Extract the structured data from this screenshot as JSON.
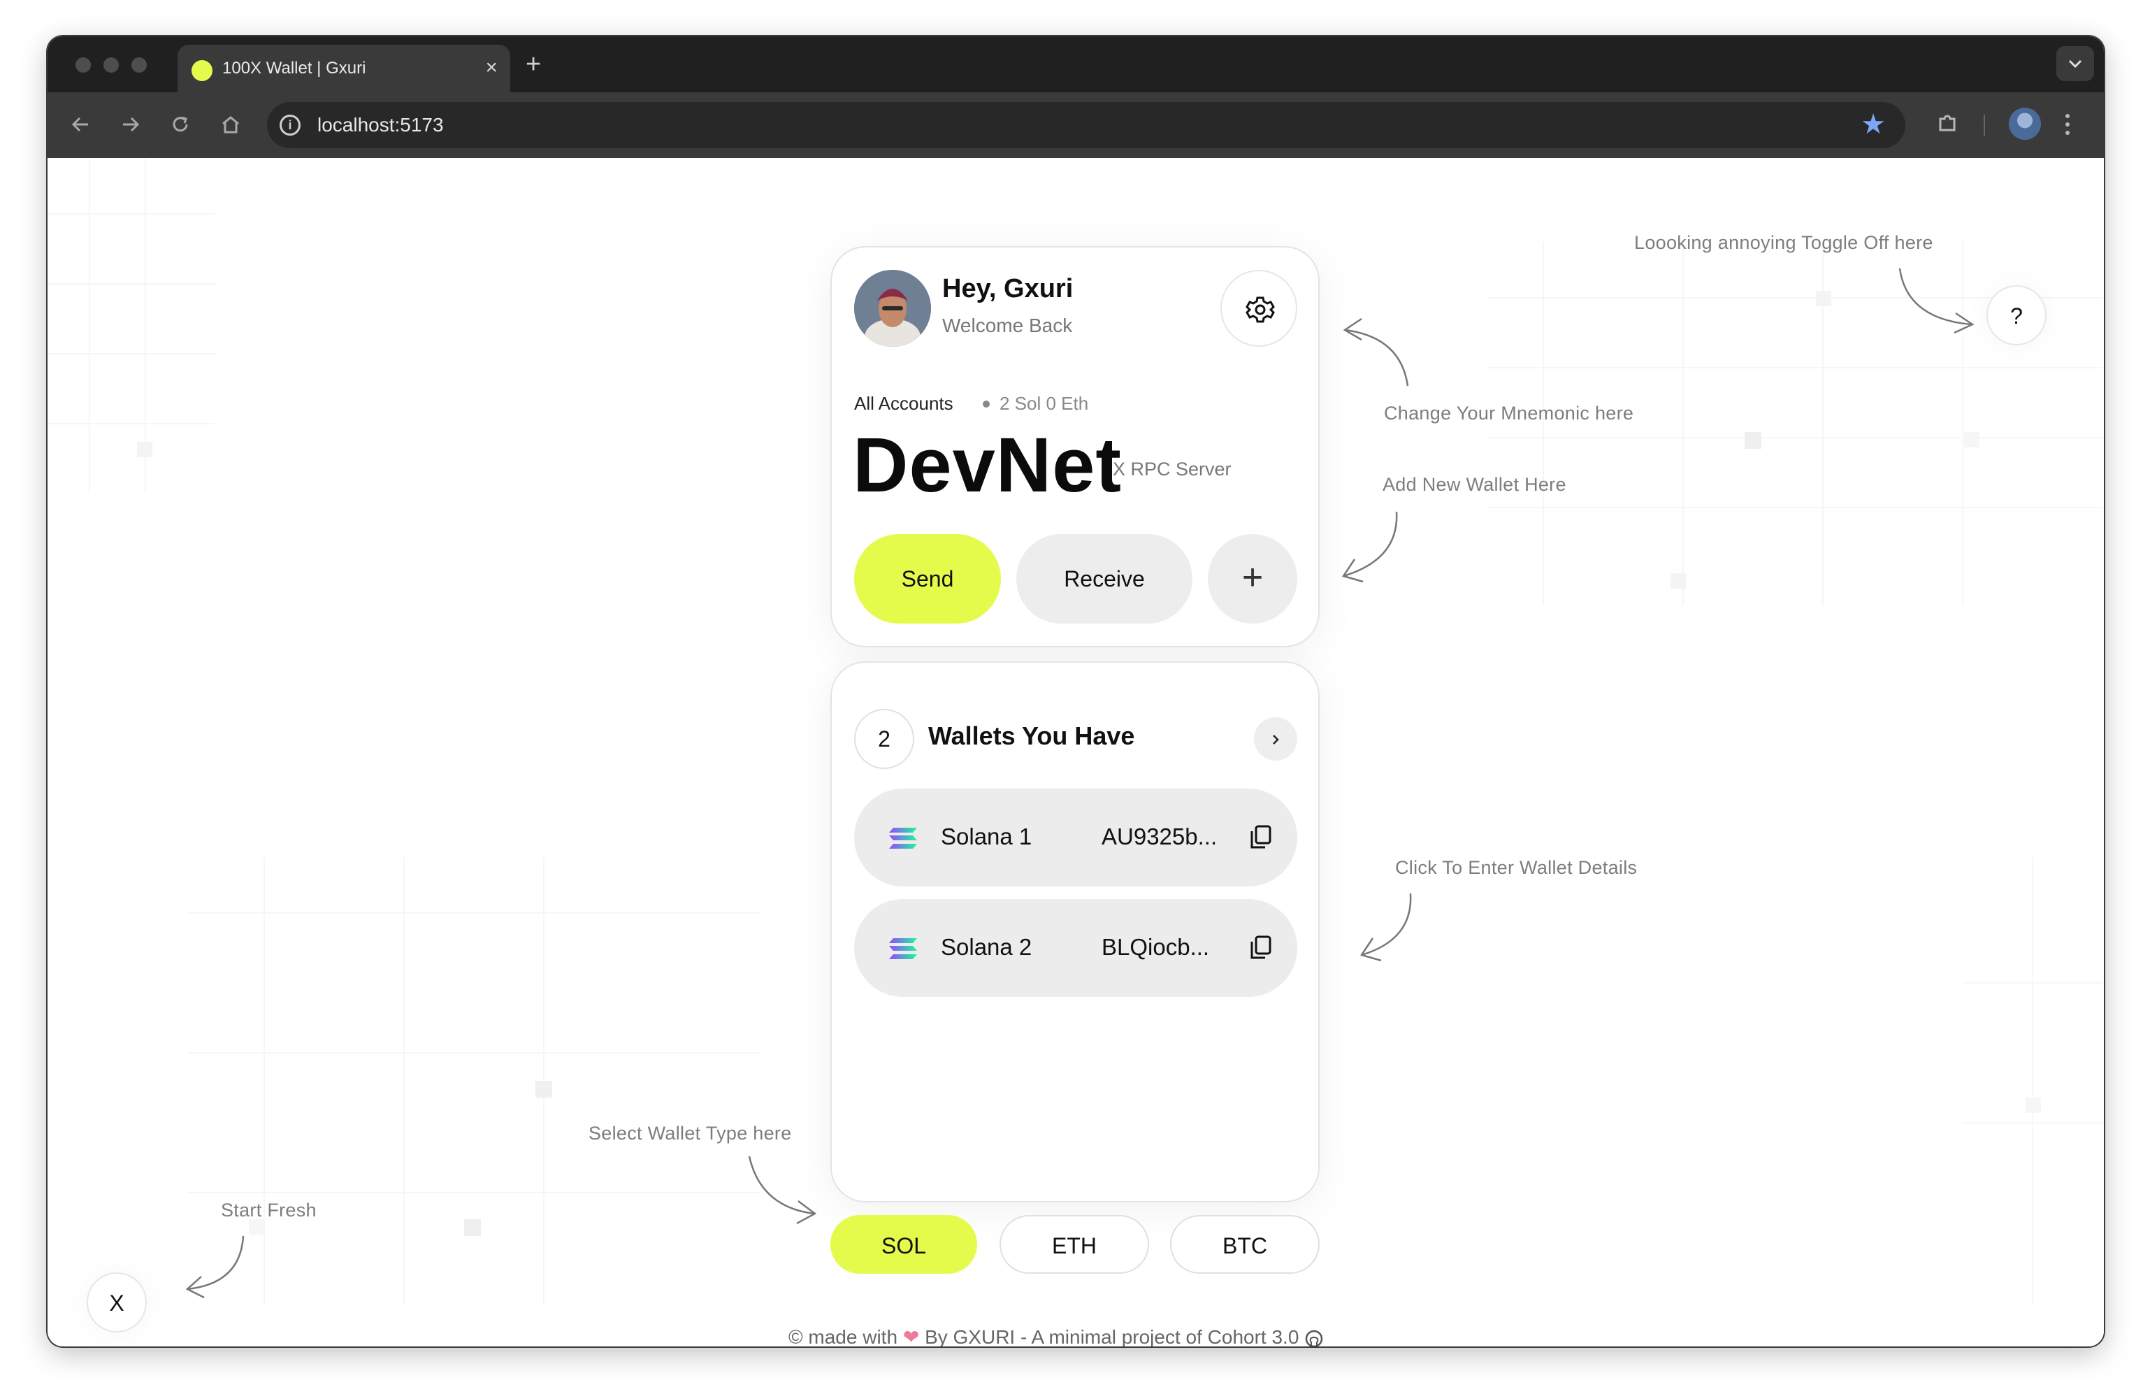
{
  "browser": {
    "tab_title": "100X Wallet | Gxuri",
    "tab_close": "×",
    "new_tab": "+",
    "url": "localhost:5173",
    "accent": "#e4fb4c"
  },
  "wallet": {
    "greeting": "Hey, Gxuri",
    "welcome": "Welcome Back",
    "accounts_label": "All Accounts",
    "balance": "2 Sol 0 Eth",
    "network": "DevNet",
    "rpc_label": "X RPC Server",
    "send_label": "Send",
    "receive_label": "Receive",
    "add_label": "+",
    "wallet_count": "2",
    "wallets_title": "Wallets You Have",
    "wallets": [
      {
        "name": "Solana 1",
        "address": "AU9325b..."
      },
      {
        "name": "Solana 2",
        "address": "BLQiocb..."
      }
    ],
    "chains": [
      "SOL",
      "ETH",
      "BTC"
    ],
    "active_chain": "SOL"
  },
  "hints": {
    "toggle": "Loooking annoying Toggle Off here",
    "mnemonic": "Change Your Mnemonic here",
    "add_wallet": "Add New Wallet Here",
    "wallet_details": "Click To Enter Wallet Details",
    "wallet_type": "Select Wallet Type here",
    "start_fresh": "Start Fresh"
  },
  "controls": {
    "help_label": "?",
    "reset_label": "X"
  },
  "footer": {
    "prefix": "© made with",
    "by": "By",
    "author": "GXURI",
    "suffix": "- A minimal project of Cohort 3.0"
  }
}
